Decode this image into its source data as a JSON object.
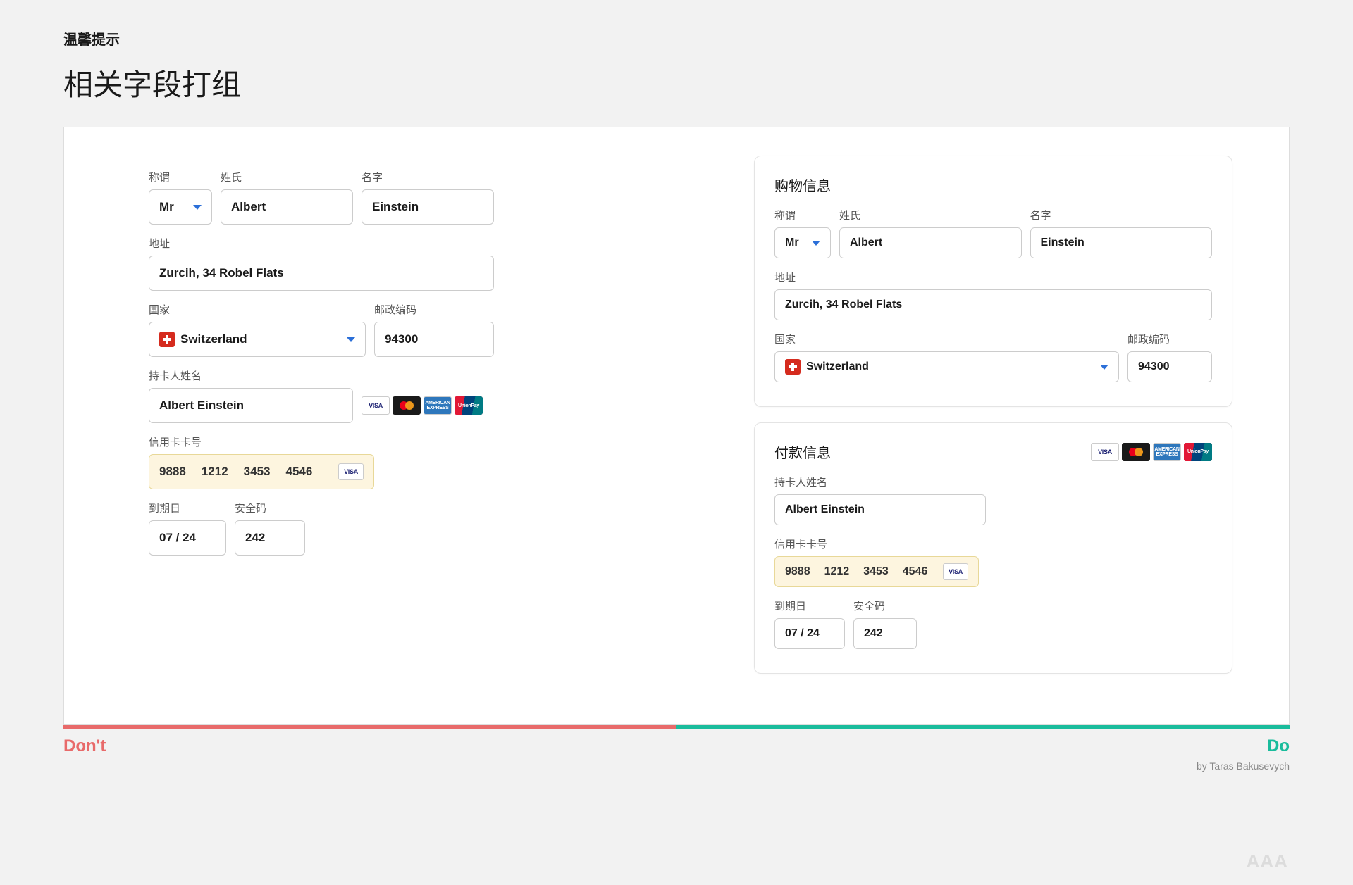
{
  "header": {
    "tip": "温馨提示",
    "title": "相关字段打组"
  },
  "labels": {
    "salutation": "称谓",
    "lastname": "姓氏",
    "firstname": "名字",
    "address": "地址",
    "country": "国家",
    "postcode": "邮政编码",
    "cardholder": "持卡人姓名",
    "cardnumber": "信用卡卡号",
    "expiry": "到期日",
    "cvc": "安全码"
  },
  "values": {
    "salutation": "Mr",
    "lastname": "Albert",
    "firstname": "Einstein",
    "address": "Zurcih, 34 Robel Flats",
    "country": "Switzerland",
    "postcode": "94300",
    "cardholder": "Albert Einstein",
    "cardnumber": [
      "9888",
      "1212",
      "3453",
      "4546"
    ],
    "expiry": "07 / 24",
    "cvc": "242"
  },
  "sections": {
    "shopping_info": "购物信息",
    "payment_info": "付款信息"
  },
  "card_brands": {
    "visa": "VISA",
    "amex": "AMERICAN EXPRESS",
    "unionpay": "UnionPay"
  },
  "footer": {
    "dont": "Don't",
    "do": "Do",
    "byline": "by Taras Bakusevych",
    "watermark": "AAA"
  }
}
